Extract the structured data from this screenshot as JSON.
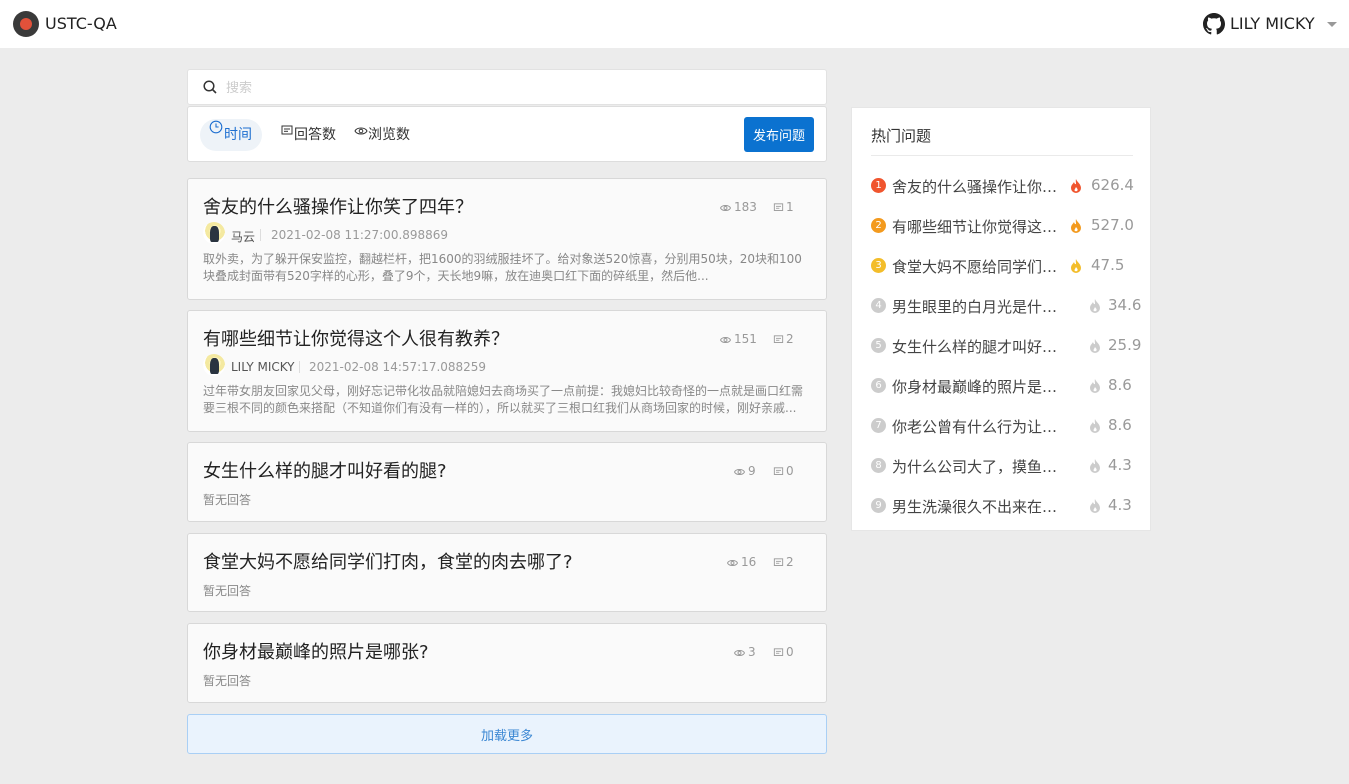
{
  "header": {
    "brand": "USTC-QA",
    "user_name": "LILY MICKY"
  },
  "search": {
    "placeholder": "搜索"
  },
  "sort": {
    "time": "时间",
    "answers": "回答数",
    "views": "浏览数",
    "publish": "发布问题"
  },
  "questions": [
    {
      "title": "舍友的什么骚操作让你笑了四年？",
      "views": "183",
      "answers": "1",
      "author": "马云",
      "time": "2021-02-08 11:27:00.898869",
      "excerpt": "取外卖，为了躲开保安监控，翻越栏杆，把1600的羽绒服挂坏了。给对象送520惊喜，分别用50块，20块和100块叠成封面带有520字样的心形，叠了9个，天长地9嘛，放在迪奥口红下面的碎纸里，然后他..."
    },
    {
      "title": "有哪些细节让你觉得这个人很有教养？",
      "views": "151",
      "answers": "2",
      "author": "LILY MICKY",
      "time": "2021-02-08 14:57:17.088259",
      "excerpt": "过年带女朋友回家见父母，刚好忘记带化妆品就陪媳妇去商场买了一点前提：我媳妇比较奇怪的一点就是画口红需要三根不同的颜色来搭配（不知道你们有没有一样的），所以就买了三根口红我们从商场回家的时候，刚好亲戚..."
    },
    {
      "title": "女生什么样的腿才叫好看的腿?",
      "views": "9",
      "answers": "0",
      "noans": "暂无回答"
    },
    {
      "title": "食堂大妈不愿给同学们打肉，食堂的肉去哪了?",
      "views": "16",
      "answers": "2",
      "noans": "暂无回答"
    },
    {
      "title": "你身材最巅峰的照片是哪张?",
      "views": "3",
      "answers": "0",
      "noans": "暂无回答"
    }
  ],
  "load_more": "加载更多",
  "hot": {
    "title": "热门问题",
    "items": [
      {
        "rank": "1",
        "text": "舍友的什么骚操作让你笑了四年？",
        "score": "626.4",
        "color": "#f0552e"
      },
      {
        "rank": "2",
        "text": "有哪些细节让你觉得这个人很有教养？",
        "score": "527.0",
        "color": "#f39a1e"
      },
      {
        "rank": "3",
        "text": "食堂大妈不愿给同学们打肉，食堂的肉去哪了？",
        "score": "47.5",
        "color": "#f3bd2a"
      },
      {
        "rank": "4",
        "text": "男生眼里的白月光是什么样的？",
        "score": "34.6",
        "color": "#cccccc"
      },
      {
        "rank": "5",
        "text": "女生什么样的腿才叫好看的腿？",
        "score": "25.9",
        "color": "#cccccc"
      },
      {
        "rank": "6",
        "text": "你身材最巅峰的照片是哪张？",
        "score": "8.6",
        "color": "#cccccc"
      },
      {
        "rank": "7",
        "text": "你老公曾有什么行为让你感动？",
        "score": "8.6",
        "color": "#cccccc"
      },
      {
        "rank": "8",
        "text": "为什么公司大了，摸鱼的人多了？",
        "score": "4.3",
        "color": "#cccccc"
      },
      {
        "rank": "9",
        "text": "男生洗澡很久不出来在干嘛？",
        "score": "4.3",
        "color": "#cccccc"
      }
    ]
  }
}
